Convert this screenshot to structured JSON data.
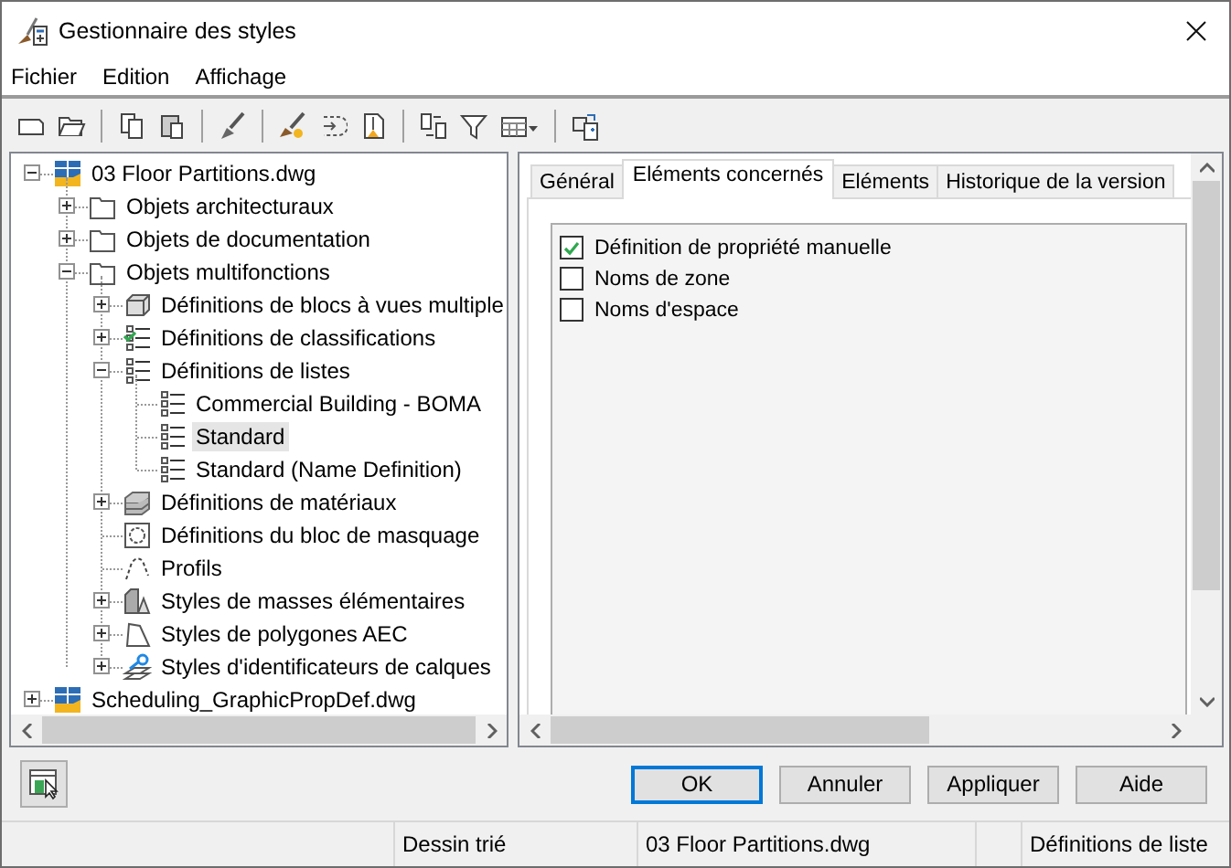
{
  "window": {
    "title": "Gestionnaire des styles"
  },
  "menu": [
    "Fichier",
    "Edition",
    "Affichage"
  ],
  "tree": [
    {
      "label": "03 Floor Partitions.dwg",
      "kind": "drawing",
      "expanded": true,
      "selected": false,
      "children": [
        {
          "label": "Objets architecturaux",
          "kind": "folder",
          "expanded": false,
          "selected": false
        },
        {
          "label": "Objets de documentation",
          "kind": "folder",
          "expanded": false,
          "selected": false
        },
        {
          "label": "Objets multifonctions",
          "kind": "folder",
          "expanded": true,
          "selected": false,
          "children": [
            {
              "label": "Définitions de blocs à vues multiple",
              "kind": "block-views",
              "expanded": false,
              "selected": false
            },
            {
              "label": "Définitions de classifications",
              "kind": "classification",
              "expanded": false,
              "selected": false
            },
            {
              "label": "Définitions de listes",
              "kind": "list",
              "expanded": true,
              "selected": false,
              "children": [
                {
                  "label": "Commercial Building - BOMA",
                  "kind": "list",
                  "selected": false
                },
                {
                  "label": "Standard",
                  "kind": "list",
                  "selected": true
                },
                {
                  "label": "Standard (Name Definition)",
                  "kind": "list",
                  "selected": false
                }
              ]
            },
            {
              "label": "Définitions de matériaux",
              "kind": "material",
              "expanded": false,
              "selected": false
            },
            {
              "label": "Définitions du bloc de masquage",
              "kind": "mask",
              "selected": false
            },
            {
              "label": "Profils",
              "kind": "profile",
              "selected": false
            },
            {
              "label": "Styles de masses élémentaires",
              "kind": "mass",
              "expanded": false,
              "selected": false
            },
            {
              "label": "Styles de polygones AEC",
              "kind": "polygon",
              "expanded": false,
              "selected": false
            },
            {
              "label": "Styles d'identificateurs de calques",
              "kind": "layer-key",
              "expanded": false,
              "selected": false
            }
          ]
        }
      ]
    },
    {
      "label": "Scheduling_GraphicPropDef.dwg",
      "kind": "drawing",
      "expanded": false,
      "selected": false
    }
  ],
  "tabs": [
    {
      "label": "Général",
      "selected": false
    },
    {
      "label": "Eléments concernés",
      "selected": true
    },
    {
      "label": "Eléments",
      "selected": false
    },
    {
      "label": "Historique de la version",
      "selected": false
    }
  ],
  "checklist": [
    {
      "label": "Définition de propriété manuelle",
      "checked": true
    },
    {
      "label": "Noms de zone",
      "checked": false
    },
    {
      "label": "Noms d'espace",
      "checked": false
    }
  ],
  "buttons": [
    {
      "label": "OK",
      "default": true
    },
    {
      "label": "Annuler",
      "default": false
    },
    {
      "label": "Appliquer",
      "default": false
    },
    {
      "label": "Aide",
      "default": false
    }
  ],
  "status_bar": [
    "Dessin trié",
    "03 Floor Partitions.dwg",
    "Définitions de liste"
  ]
}
